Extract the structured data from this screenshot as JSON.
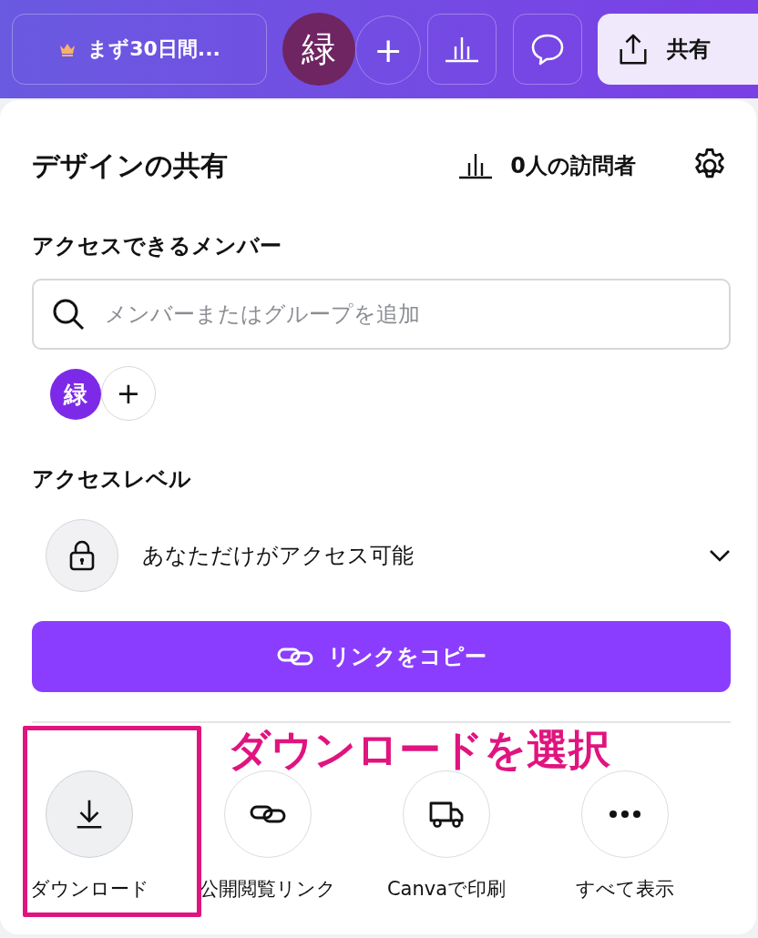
{
  "top_bar": {
    "trial_button": "まず30日間...",
    "avatar": "緑",
    "add_button": "+",
    "share_button": "共有"
  },
  "share_panel": {
    "title": "デザインの共有",
    "visitors": "0人の訪問者",
    "members_heading": "アクセスできるメンバー",
    "search": {
      "placeholder": "メンバーまたはグループを追加"
    },
    "member_avatar": "緑",
    "member_add": "+",
    "access_heading": "アクセスレベル",
    "access_level": "あなただけがアクセス可能",
    "copy_link_button": "リンクをコピー",
    "options": [
      {
        "kind": "download",
        "label": "ダウンロード",
        "selected": true
      },
      {
        "kind": "link",
        "label": "公開閲覧リンク",
        "selected": false
      },
      {
        "kind": "print",
        "label": "Canvaで印刷",
        "selected": false
      },
      {
        "kind": "more",
        "label": "すべて表示",
        "selected": false
      }
    ]
  },
  "annotation": "ダウンロードを選択"
}
